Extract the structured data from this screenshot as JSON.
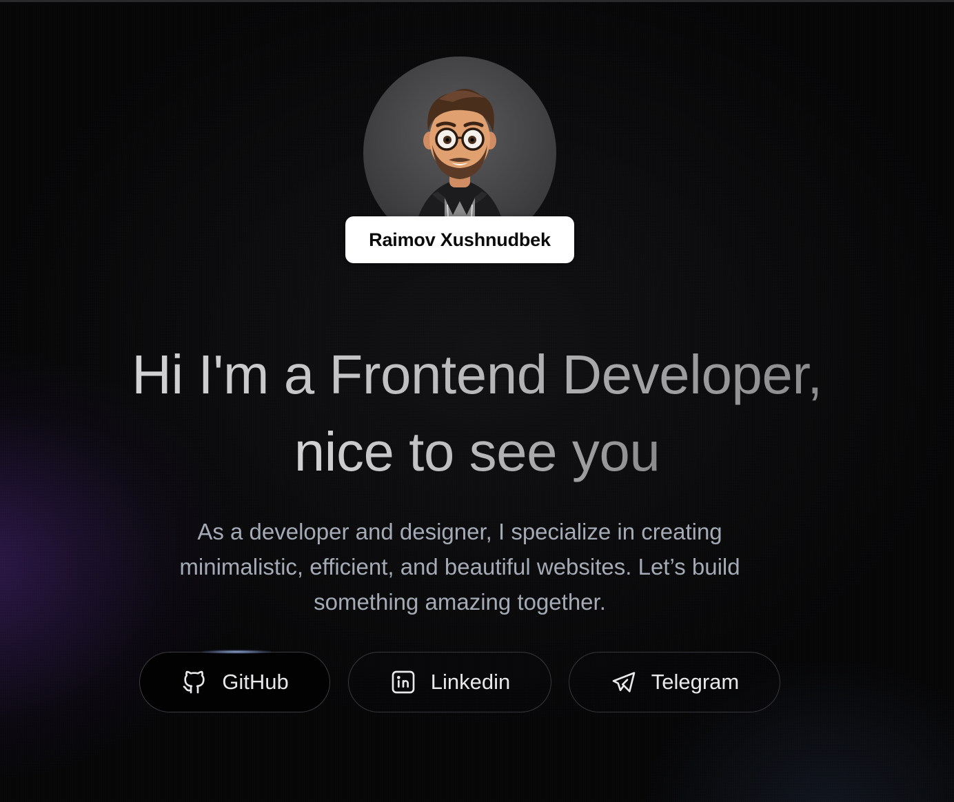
{
  "profile": {
    "name": "Raimov Xushnudbek",
    "avatar": "memoji-avatar"
  },
  "hero": {
    "headline_line1": "Hi I'm a Frontend Developer,",
    "headline_line2": "nice to see you",
    "intro_line1": "As a developer and designer, I specialize in creating",
    "intro_line2": "minimalistic, efficient, and beautiful websites. Let’s build",
    "intro_line3": "something amazing together."
  },
  "social": {
    "github": {
      "label": "GitHub",
      "icon": "github-icon"
    },
    "linkedin": {
      "label": "Linkedin",
      "icon": "linkedin-icon"
    },
    "telegram": {
      "label": "Telegram",
      "icon": "telegram-icon"
    }
  },
  "colors": {
    "background": "#060607",
    "accent_glow": "#4e2882",
    "badge_bg": "#ffffff",
    "text_muted": "#a5abb6"
  }
}
